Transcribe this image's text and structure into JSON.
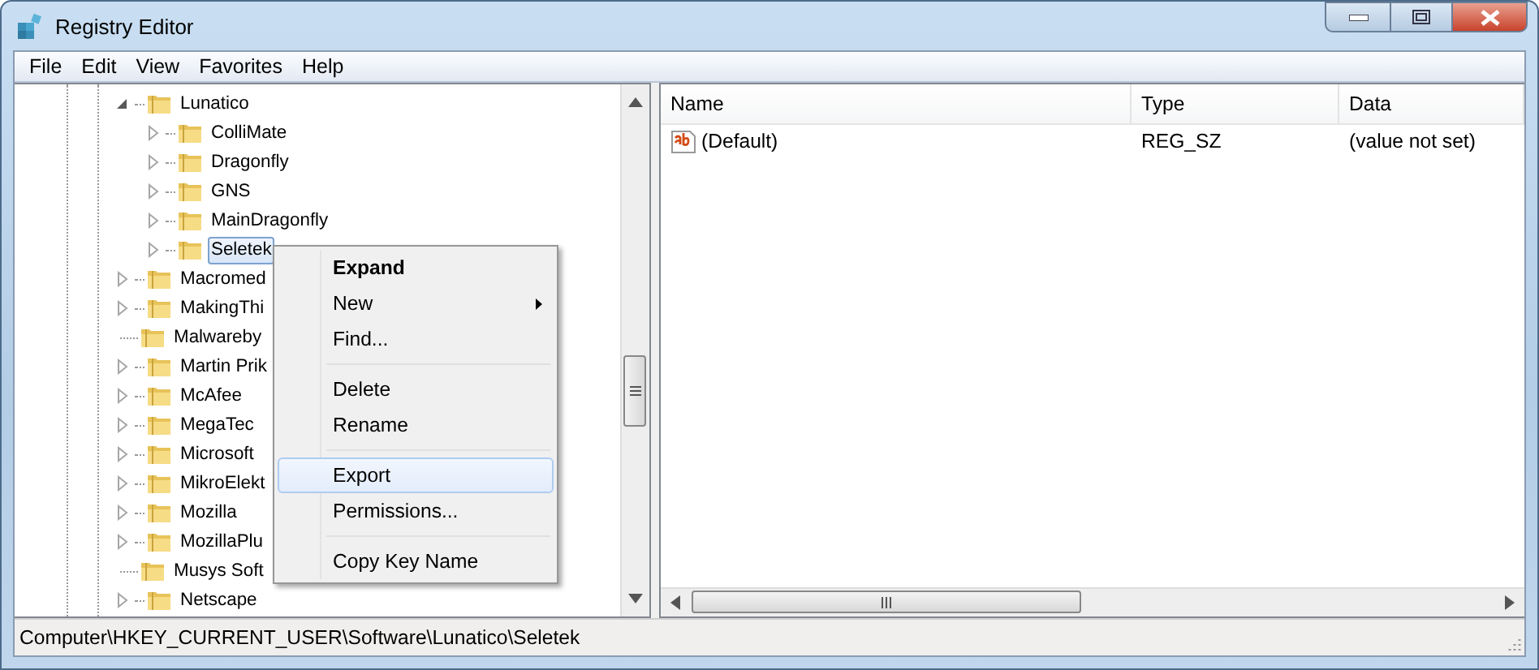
{
  "window": {
    "title": "Registry Editor"
  },
  "menu_bar": [
    "File",
    "Edit",
    "View",
    "Favorites",
    "Help"
  ],
  "tree": [
    {
      "label": "Lunatico",
      "expandable": true,
      "expanded": true,
      "selected": false,
      "children": [
        {
          "label": "ColliMate",
          "expandable": true,
          "expanded": false,
          "selected": false
        },
        {
          "label": "Dragonfly",
          "expandable": true,
          "expanded": false,
          "selected": false
        },
        {
          "label": "GNS",
          "expandable": true,
          "expanded": false,
          "selected": false
        },
        {
          "label": "MainDragonfly",
          "expandable": true,
          "expanded": false,
          "selected": false
        },
        {
          "label": "Seletek",
          "expandable": true,
          "expanded": false,
          "selected": true
        }
      ]
    },
    {
      "label": "Macromed",
      "expandable": true,
      "expanded": false,
      "selected": false
    },
    {
      "label": "MakingThi",
      "expandable": true,
      "expanded": false,
      "selected": false
    },
    {
      "label": "Malwareby",
      "expandable": false,
      "selected": false
    },
    {
      "label": "Martin Prik",
      "expandable": true,
      "expanded": false,
      "selected": false
    },
    {
      "label": "McAfee",
      "expandable": true,
      "expanded": false,
      "selected": false
    },
    {
      "label": "MegaTec",
      "expandable": true,
      "expanded": false,
      "selected": false
    },
    {
      "label": "Microsoft",
      "expandable": true,
      "expanded": false,
      "selected": false
    },
    {
      "label": "MikroElekt",
      "expandable": true,
      "expanded": false,
      "selected": false
    },
    {
      "label": "Mozilla",
      "expandable": true,
      "expanded": false,
      "selected": false
    },
    {
      "label": "MozillaPlu",
      "expandable": true,
      "expanded": false,
      "selected": false
    },
    {
      "label": "Musys Soft",
      "expandable": false,
      "selected": false
    },
    {
      "label": "Netscape",
      "expandable": true,
      "expanded": false,
      "selected": false
    }
  ],
  "context_menu": [
    {
      "kind": "item",
      "label": "Expand",
      "default": true,
      "submenu": false,
      "selected": false
    },
    {
      "kind": "item",
      "label": "New",
      "default": false,
      "submenu": true,
      "selected": false
    },
    {
      "kind": "item",
      "label": "Find...",
      "default": false,
      "submenu": false,
      "selected": false
    },
    {
      "kind": "separator"
    },
    {
      "kind": "item",
      "label": "Delete",
      "default": false,
      "submenu": false,
      "selected": false
    },
    {
      "kind": "item",
      "label": "Rename",
      "default": false,
      "submenu": false,
      "selected": false
    },
    {
      "kind": "separator"
    },
    {
      "kind": "item",
      "label": "Export",
      "default": false,
      "submenu": false,
      "selected": true
    },
    {
      "kind": "item",
      "label": "Permissions...",
      "default": false,
      "submenu": false,
      "selected": false
    },
    {
      "kind": "separator"
    },
    {
      "kind": "item",
      "label": "Copy Key Name",
      "default": false,
      "submenu": false,
      "selected": false
    }
  ],
  "values_table": {
    "columns": [
      "Name",
      "Type",
      "Data"
    ],
    "rows": [
      {
        "name": "(Default)",
        "type": "REG_SZ",
        "data": "(value not set)"
      }
    ]
  },
  "status_bar": "Computer\\HKEY_CURRENT_USER\\Software\\Lunatico\\Seletek"
}
